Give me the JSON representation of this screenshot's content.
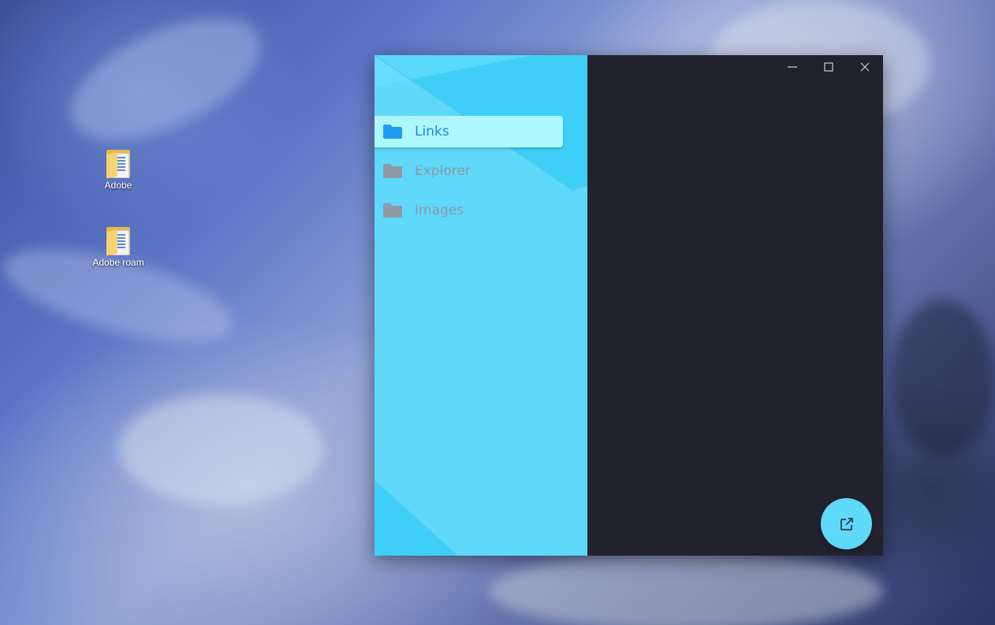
{
  "desktop": {
    "icons": [
      {
        "label": "Adobe",
        "icon": "folder-icon"
      },
      {
        "label": "Adobe roam",
        "icon": "folder-icon"
      }
    ]
  },
  "window": {
    "controls": {
      "minimize": "minimize-icon",
      "maximize": "maximize-icon",
      "close": "close-icon"
    },
    "sidebar": {
      "items": [
        {
          "label": "Links",
          "icon": "folder-icon",
          "active": true
        },
        {
          "label": "Explorer",
          "icon": "folder-icon",
          "active": false
        },
        {
          "label": "Images",
          "icon": "folder-icon",
          "active": false
        }
      ]
    },
    "fab": {
      "icon": "open-external-icon"
    }
  },
  "colors": {
    "sidebar_bg": "#5fd8f9",
    "sidebar_accent": "#3ecff7",
    "active_item_bg": "#aef8fd",
    "active_text": "#1e88d6",
    "active_folder": "#1e9cf0",
    "inactive_text": "#8d9aa6",
    "inactive_folder": "#8e9aa3",
    "content_bg": "#22222e"
  }
}
